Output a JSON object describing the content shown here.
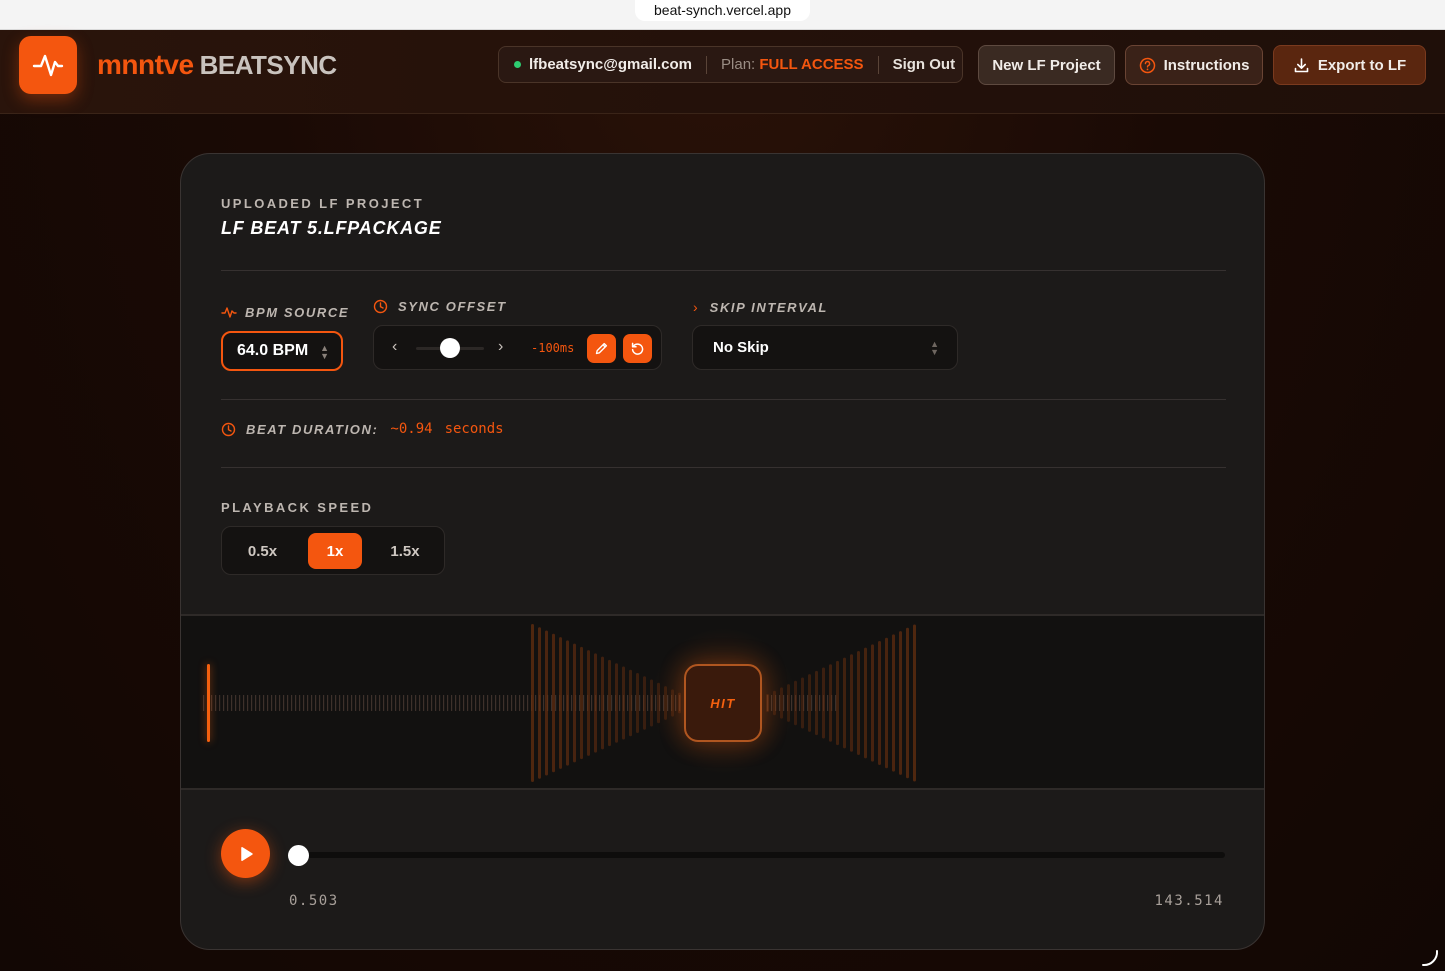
{
  "browser": {
    "url": "beat-synch.vercel.app"
  },
  "header": {
    "brand_primary": "mnntve",
    "brand_secondary": "BEATSYNC",
    "account": {
      "email": "lfbeatsync@gmail.com",
      "plan_prefix": "Plan:",
      "plan_value": "FULL ACCESS",
      "signout_label": "Sign Out",
      "status_color": "#2ecc71"
    },
    "new_project_label": "New LF Project",
    "instructions_label": "Instructions",
    "export_label": "Export to LF"
  },
  "project": {
    "label": "UPLOADED LF PROJECT",
    "name": "LF BEAT 5.LFPACKAGE"
  },
  "bpm": {
    "label": "BPM SOURCE",
    "value": "64.0 BPM"
  },
  "sync_offset": {
    "label": "SYNC OFFSET",
    "value": "-100ms",
    "slider_level": 0.5
  },
  "skip_interval": {
    "label": "SKIP INTERVAL",
    "value": "No Skip"
  },
  "beat_duration": {
    "label": "BEAT DURATION:",
    "value": "~0.94",
    "unit": "seconds"
  },
  "playback_speed": {
    "label": "PLAYBACK SPEED",
    "options": [
      "0.5x",
      "1x",
      "1.5x"
    ],
    "selected": "1x"
  },
  "waveform": {
    "hit_label": "HIT"
  },
  "transport": {
    "current_time": "0.503",
    "total_time": "143.514",
    "progress": 0.0035
  },
  "theme": {
    "accent": "#f4560f",
    "background": "#1a0a05",
    "card": "#1c1a19"
  }
}
